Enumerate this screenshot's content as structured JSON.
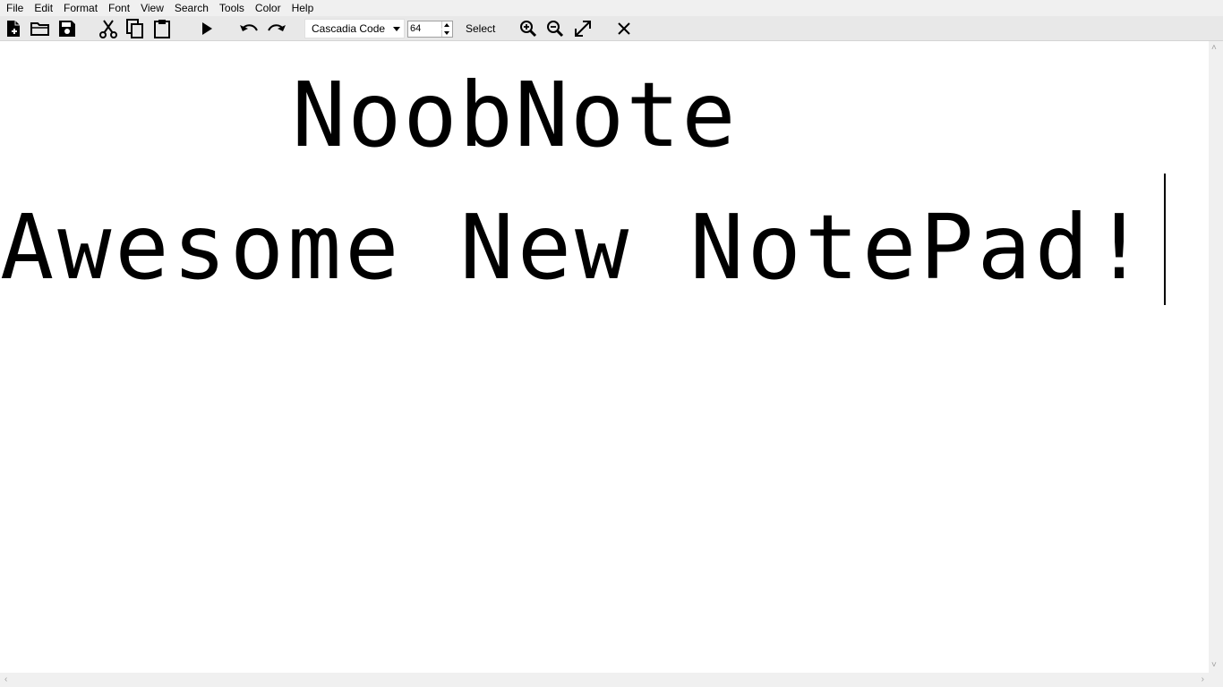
{
  "menu": {
    "file": "File",
    "edit": "Edit",
    "format": "Format",
    "font": "Font",
    "view": "View",
    "search": "Search",
    "tools": "Tools",
    "color": "Color",
    "help": "Help"
  },
  "toolbar": {
    "font_name": "Cascadia Code",
    "font_size": "64",
    "select_label": "Select",
    "icons": [
      "new-file-icon",
      "open-folder-icon",
      "save-icon",
      "cut-icon",
      "copy-icon",
      "paste-icon",
      "run-icon",
      "undo-icon",
      "redo-icon",
      "zoom-in-icon",
      "zoom-out-icon",
      "fullscreen-icon",
      "close-icon"
    ]
  },
  "editor": {
    "line1": "NoobNote",
    "line2": "Awesome New NotePad!"
  },
  "colors": {
    "menubar_bg": "#f0f0f0",
    "toolbar_bg": "#e8e8e8",
    "editor_bg": "#ffffff",
    "text": "#000000"
  }
}
